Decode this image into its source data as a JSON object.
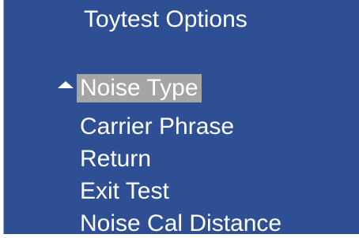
{
  "screen": {
    "title": "Toytest Options",
    "menu": {
      "selected_index": 0,
      "items": [
        {
          "label": "Noise Type"
        },
        {
          "label": "Carrier Phrase"
        },
        {
          "label": "Return"
        },
        {
          "label": "Exit Test"
        },
        {
          "label": "Noise Cal Distance"
        }
      ]
    },
    "colors": {
      "background": "#2f4f95",
      "text": "#ffffff",
      "selection_highlight": "#a5a5a5"
    }
  }
}
